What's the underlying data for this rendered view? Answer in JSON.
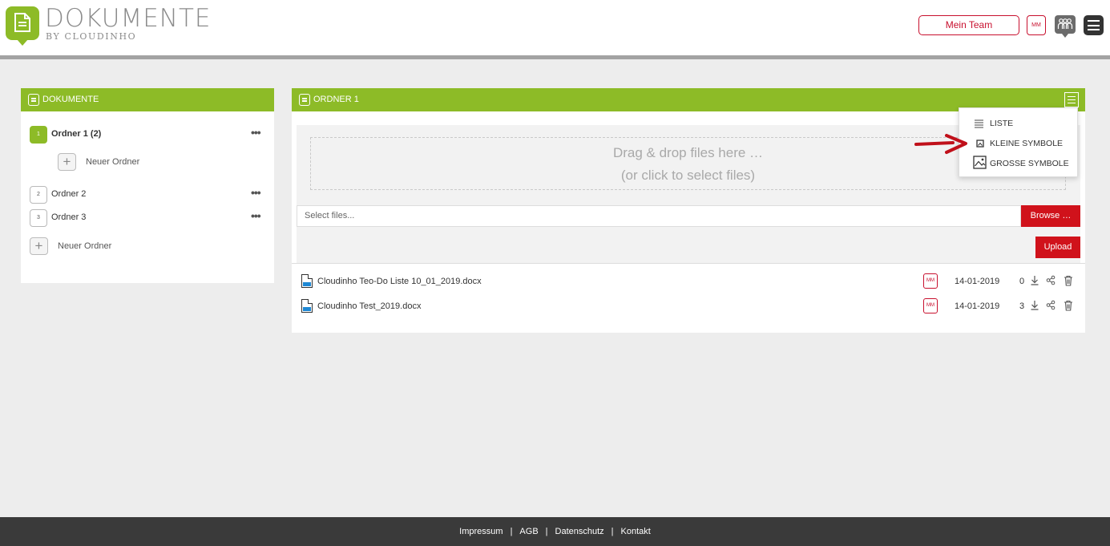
{
  "header": {
    "logo_title": "DOKUMENTE",
    "logo_subtitle": "BY CLOUDINHO",
    "team_button": "Mein Team",
    "avatar_initials": "MM"
  },
  "sidebar": {
    "title": "DOKUMENTE",
    "folders": [
      {
        "number": "1",
        "label": "Ordner 1 (2)",
        "active": true
      },
      {
        "number": "2",
        "label": "Ordner 2",
        "active": false
      },
      {
        "number": "3",
        "label": "Ordner 3",
        "active": false
      }
    ],
    "new_subfolder_label": "Neuer Ordner",
    "new_folder_label": "Neuer Ordner",
    "more_label": "•••"
  },
  "main": {
    "title": "ORDNER 1",
    "dropzone_line1": "Drag & drop files here …",
    "dropzone_line2": "(or click to select files)",
    "file_input_placeholder": "Select files...",
    "browse_label": "Browse …",
    "upload_label": "Upload",
    "files": [
      {
        "name": "Cloudinho Teo-Do Liste 10_01_2019.docx",
        "owner": "MM",
        "date": "14-01-2019",
        "count": "0"
      },
      {
        "name": "Cloudinho Test_2019.docx",
        "owner": "MM",
        "date": "14-01-2019",
        "count": "3"
      }
    ]
  },
  "view_menu": {
    "items": [
      {
        "label": "LISTE",
        "icon": "list-icon"
      },
      {
        "label": "KLEINE SYMBOLE",
        "icon": "small-icons-icon"
      },
      {
        "label": "GROSSE SYMBOLE",
        "icon": "large-icons-icon"
      }
    ]
  },
  "footer": {
    "links": [
      "Impressum",
      "AGB",
      "Datenschutz",
      "Kontakt"
    ],
    "separator": "|"
  },
  "colors": {
    "brand_green": "#8dbb27",
    "accent_red": "#d0121b",
    "footer_bg": "#3a3a3a"
  }
}
